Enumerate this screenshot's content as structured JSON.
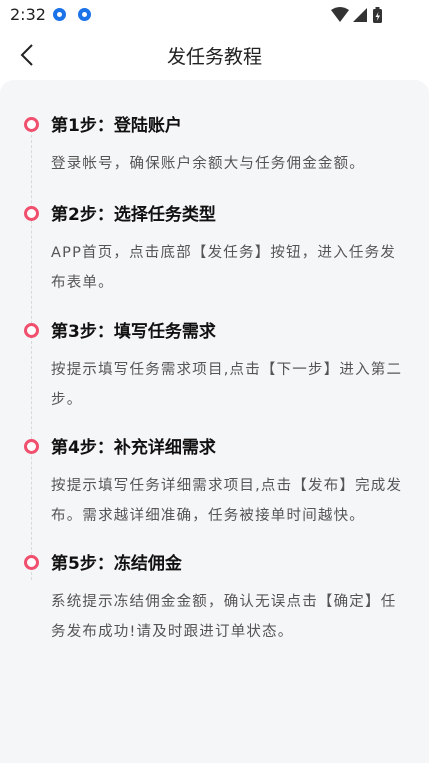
{
  "status_bar": {
    "time": "2:32",
    "icons": [
      "notification-app-icon",
      "notification-app-icon",
      "wifi-icon",
      "signal-icon",
      "battery-charging-icon"
    ]
  },
  "header": {
    "title": "发任务教程",
    "back_icon": "chevron-left-icon"
  },
  "steps": [
    {
      "title": "第1步：登陆账户",
      "desc": "登录帐号，确保账户余额大与任务佣金金额。"
    },
    {
      "title": "第2步：选择任务类型",
      "desc": "APP首页，点击底部【发任务】按钮，进入任务发布表单。"
    },
    {
      "title": "第3步：填写任务需求",
      "desc": "按提示填写任务需求项目,点击【下一步】进入第二步。"
    },
    {
      "title": "第4步：补充详细需求",
      "desc": "按提示填写任务详细需求项目,点击【发布】完成发布。需求越详细准确，任务被接单时间越快。"
    },
    {
      "title": "第5步：冻结佣金",
      "desc": "系统提示冻结佣金金额，确认无误点击【确定】任务发布成功!请及时跟进订单状态。"
    }
  ],
  "colors": {
    "accent": "#f0506e",
    "background": "#f5f6f8",
    "status_icon_blue": "#1a73e8"
  }
}
